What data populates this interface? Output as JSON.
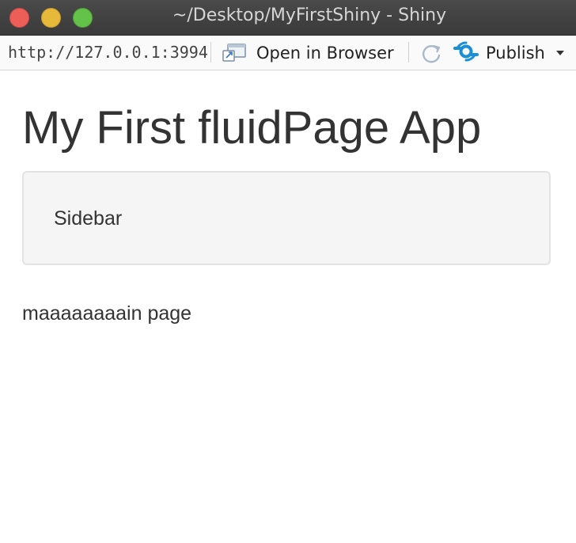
{
  "window": {
    "title": "~/Desktop/MyFirstShiny - Shiny"
  },
  "toolbar": {
    "url": "http://127.0.0.1:3994",
    "open_in_browser_label": "Open in Browser",
    "publish_label": "Publish",
    "icons": {
      "open_in_browser": "open-in-browser-icon",
      "refresh": "refresh-icon",
      "publish": "publish-icon",
      "publish_dropdown": "chevron-down-icon"
    },
    "colors": {
      "publish_icon": "#1a8fd8"
    }
  },
  "page": {
    "title": "My First fluidPage App",
    "sidebar_text": "Sidebar",
    "main_text": "maaaaaaaain page"
  },
  "colors": {
    "text": "#333333",
    "sidebar_bg": "#f5f5f5",
    "sidebar_border": "#e3e3e3",
    "titlebar_bg": "#3e3e3e",
    "close": "#ee5e58",
    "minimize": "#e7b93a",
    "maximize": "#64c14a"
  }
}
